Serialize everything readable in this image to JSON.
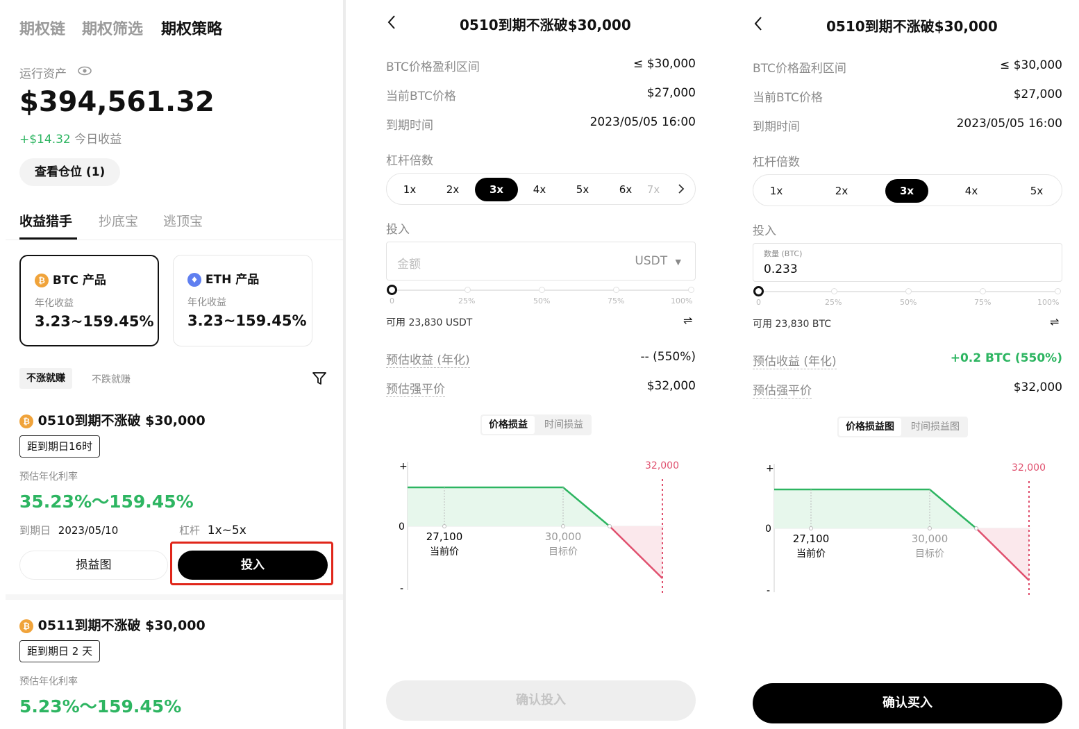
{
  "left": {
    "top_tabs": [
      "期权链",
      "期权筛选",
      "期权策略"
    ],
    "assets_label": "运行资产",
    "assets_value": "$394,561.32",
    "today_gain": "+$14.32",
    "today_gain_label": "今日收益",
    "positions_button": "查看仓位 (1)",
    "sub_tabs": [
      "收益猎手",
      "抄底宝",
      "逃顶宝"
    ],
    "products": [
      {
        "coin_icon": "₿",
        "name": "BTC 产品",
        "rate_label": "年化收益",
        "rate": "3.23~159.45%"
      },
      {
        "coin_icon": "♦",
        "name": "ETH 产品",
        "rate_label": "年化收益",
        "rate": "3.23~159.45%"
      }
    ],
    "filters": [
      "不涨就赚",
      "不跌就赚"
    ],
    "items": [
      {
        "coin_icon": "₿",
        "title": "0510到期不涨破 $30,000",
        "tag": "距到期日16时",
        "rate_label": "预估年化利率",
        "rate": "35.23%～159.45%",
        "expiry_label": "到期日",
        "expiry": "2023/05/10",
        "leverage_label": "杠杆",
        "leverage": "1x~5x",
        "chart_button": "损益图",
        "invest_button": "投入"
      },
      {
        "coin_icon": "₿",
        "title": "0511到期不涨破 $30,000",
        "tag": "距到期日 2 天",
        "rate_label": "预估年化利率",
        "rate": "5.23%～159.45%"
      }
    ]
  },
  "middle": {
    "title": "0510到期不涨破$30,000",
    "rows": [
      {
        "label": "BTC价格盈利区间",
        "value": "≤ $30,000"
      },
      {
        "label": "当前BTC价格",
        "value": "$27,000"
      },
      {
        "label": "到期时间",
        "value": "2023/05/05 16:00"
      }
    ],
    "leverage_label": "杠杆倍数",
    "leverage_options": [
      "1x",
      "2x",
      "3x",
      "4x",
      "5x",
      "6x",
      "7x"
    ],
    "selected_leverage": "3x",
    "invest_label": "投入",
    "amount_placeholder": "金额",
    "currency": "USDT",
    "slider_labels": [
      "0",
      "25%",
      "50%",
      "75%",
      "100%"
    ],
    "available": "可用 23,830 USDT",
    "est_label": "预估收益 (年化)",
    "est_value": "-- (550%)",
    "liq_label": "预估强平价",
    "liq_value": "$32,000",
    "chart_tabs": [
      "价格损益",
      "时间损益"
    ],
    "confirm": "确认投入"
  },
  "right": {
    "title": "0510到期不涨破$30,000",
    "rows": [
      {
        "label": "BTC价格盈利区间",
        "value": "≤ $30,000"
      },
      {
        "label": "当前BTC价格",
        "value": "$27,000"
      },
      {
        "label": "到期时间",
        "value": "2023/05/05 16:00"
      }
    ],
    "leverage_label": "杠杆倍数",
    "leverage_options": [
      "1x",
      "2x",
      "3x",
      "4x",
      "5x"
    ],
    "selected_leverage": "3x",
    "invest_label": "投入",
    "qty_label": "数量 (BTC)",
    "qty_value": "0.233",
    "slider_labels": [
      "0",
      "25%",
      "50%",
      "75%",
      "100%"
    ],
    "available": "可用 23,830 BTC",
    "est_label": "预估收益 (年化)",
    "est_value": "+0.2 BTC (550%)",
    "liq_label": "预估强平价",
    "liq_value": "$32,000",
    "chart_tabs": [
      "价格损益图",
      "时间损益图"
    ],
    "confirm": "确认买入"
  },
  "chart": {
    "plus": "+",
    "zero": "0",
    "minus": "-",
    "liq_price": "32,000",
    "current_price": "27,100",
    "current_label": "当前价",
    "target_price": "30,000",
    "target_label": "目标价"
  },
  "colors": {
    "green": "#2db561",
    "red": "#e0506e",
    "accent_box": "#e0261a"
  }
}
